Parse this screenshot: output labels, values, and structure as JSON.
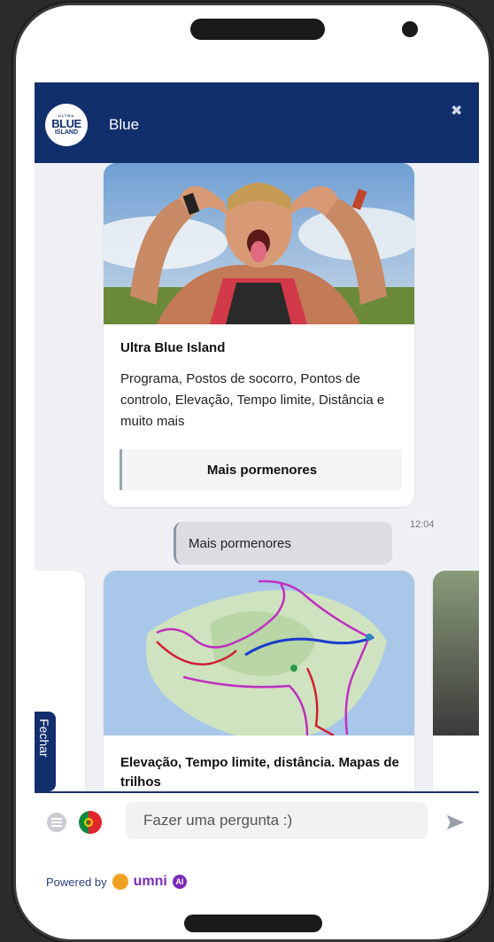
{
  "header": {
    "logo_line1": "ULTRA",
    "logo_line2": "BLUE",
    "logo_line3": "ISLAND",
    "title": "Blue",
    "close_icon": "close-icon"
  },
  "cards": [
    {
      "image": "runner-photo",
      "title": "Ultra Blue Island",
      "description": "Programa, Postos de socorro, Pontos de controlo, Elevação, Tempo limite, Distância e muito mais",
      "button": "Mais pormenores"
    },
    {
      "image": "trail-map",
      "title": "Elevação, Tempo limite, distância. Mapas de trilhos"
    }
  ],
  "user_message": {
    "text": "Mais pormenores",
    "time": "12:04"
  },
  "side_tab": "Fechar",
  "composer": {
    "placeholder": "Fazer uma pergunta :)",
    "send_icon": "send-icon",
    "menu_icon": "menu-icon",
    "language_icon": "portugal-flag-icon"
  },
  "footer": {
    "powered_by": "Powered by",
    "brand": "umni",
    "ai": "AI"
  },
  "colors": {
    "header": "#122f6d",
    "chat_bg": "#eef0f4",
    "brand": "#7b2ab8"
  }
}
